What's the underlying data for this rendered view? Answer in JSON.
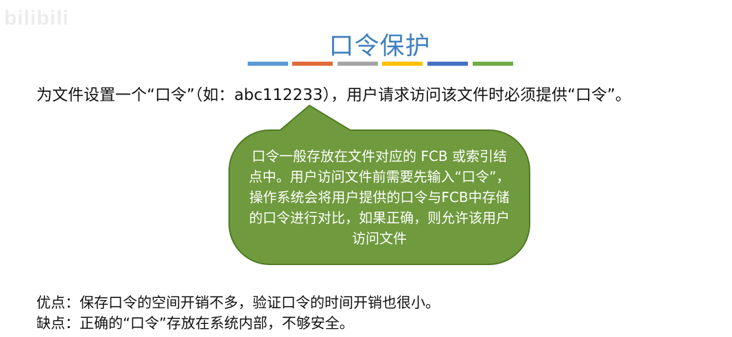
{
  "watermark": "bilibili",
  "title": "口令保护",
  "stripe_colors": [
    "#5b9bd5",
    "#e06b3a",
    "#a5a5a5",
    "#ffc000",
    "#4472c4",
    "#70ad47"
  ],
  "intro": "为文件设置一个“口令”（如：abc112233），用户请求访问该文件时必须提供“口令”。",
  "callout": {
    "text": "口令一般存放在文件对应的 FCB 或索引结点中。用户访问文件前需要先输入“口令”，操作系统会将用户提供的口令与FCB中存储的口令进行对比，如果正确，则允许该用户访问文件",
    "fill": "#6f9a3d"
  },
  "pros": "优点：保存口令的空间开销不多，验证口令的时间开销也很小。",
  "cons": "缺点：正确的“口令”存放在系统内部，不够安全。"
}
